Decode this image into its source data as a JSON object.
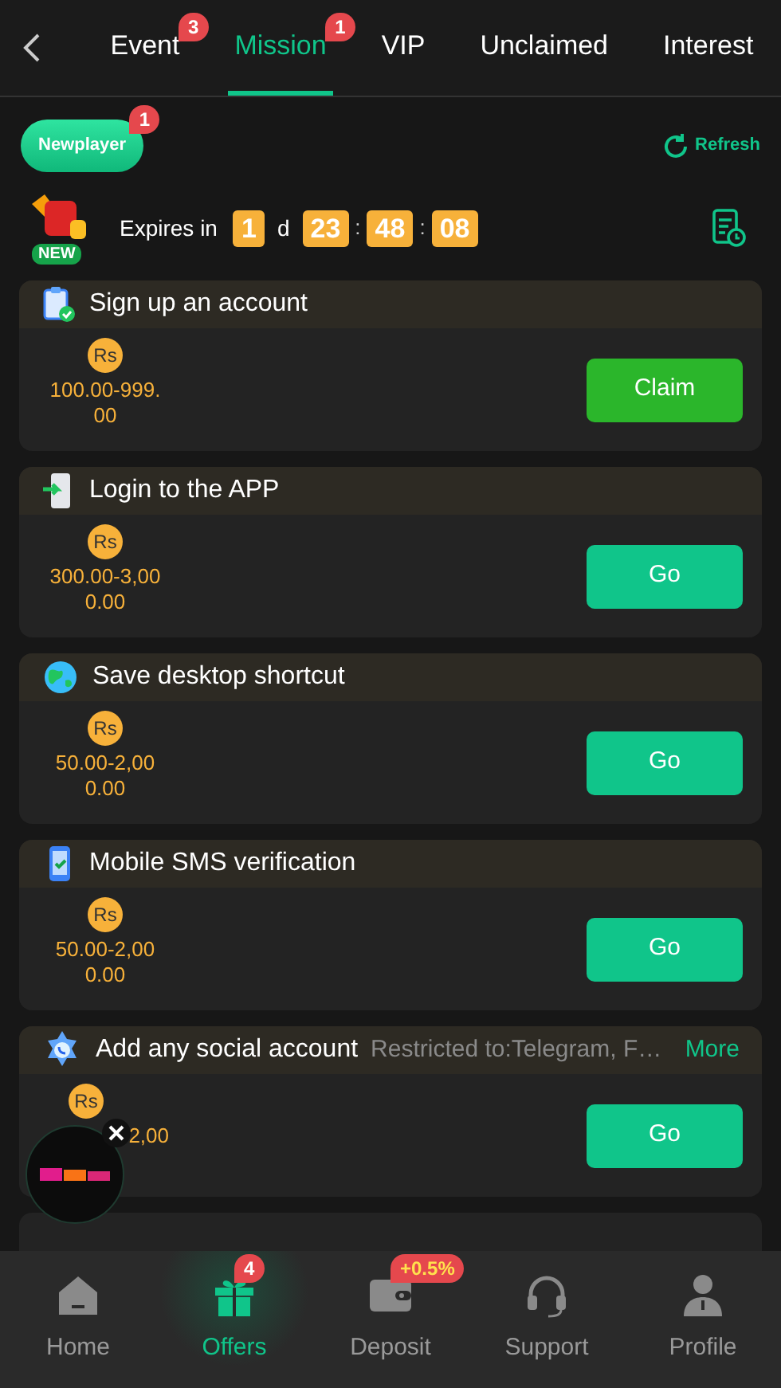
{
  "tabs": [
    {
      "label": "Event",
      "badge": "3",
      "selected": false
    },
    {
      "label": "Mission",
      "badge": "1",
      "selected": true
    },
    {
      "label": "VIP",
      "selected": false
    },
    {
      "label": "Unclaimed",
      "selected": false
    },
    {
      "label": "Interest",
      "selected": false
    }
  ],
  "category": {
    "label": "Newplayer",
    "badge": "1",
    "selected": true
  },
  "refresh": "Refresh",
  "expiry": {
    "new_tag": "NEW",
    "label": "Expires in",
    "days": "1",
    "days_unit": "d",
    "hours": "23",
    "sep1": ":",
    "minutes": "48",
    "sep2": ":",
    "seconds": "08"
  },
  "missions": [
    {
      "title": "Sign up an account",
      "currency": "Rs",
      "amount": [
        "100.00-999.",
        "00"
      ],
      "button": {
        "label": "Claim",
        "kind": "claim"
      }
    },
    {
      "title": "Login to the APP",
      "currency": "Rs",
      "amount": [
        "300.00-3,00",
        "0.00"
      ],
      "button": {
        "label": "Go",
        "kind": "go"
      }
    },
    {
      "title": "Save desktop shortcut",
      "currency": "Rs",
      "amount": [
        "50.00-2,00",
        "0.00"
      ],
      "button": {
        "label": "Go",
        "kind": "go"
      }
    },
    {
      "title": "Mobile SMS verification",
      "currency": "Rs",
      "amount": [
        "50.00-2,00",
        "0.00"
      ],
      "button": {
        "label": "Go",
        "kind": "go"
      }
    },
    {
      "title": "Add any social account",
      "note": "Restricted to:Telegram, F…",
      "more": "More",
      "currency": "Rs",
      "amount": [
        "2,00"
      ],
      "button": {
        "label": "Go",
        "kind": "go"
      }
    }
  ],
  "nav": [
    {
      "label": "Home",
      "selected": false
    },
    {
      "label": "Offers",
      "badge": "4",
      "selected": true
    },
    {
      "label": "Deposit",
      "badge": "+0.5%",
      "selected": false
    },
    {
      "label": "Support",
      "selected": false
    },
    {
      "label": "Profile",
      "selected": false
    }
  ]
}
